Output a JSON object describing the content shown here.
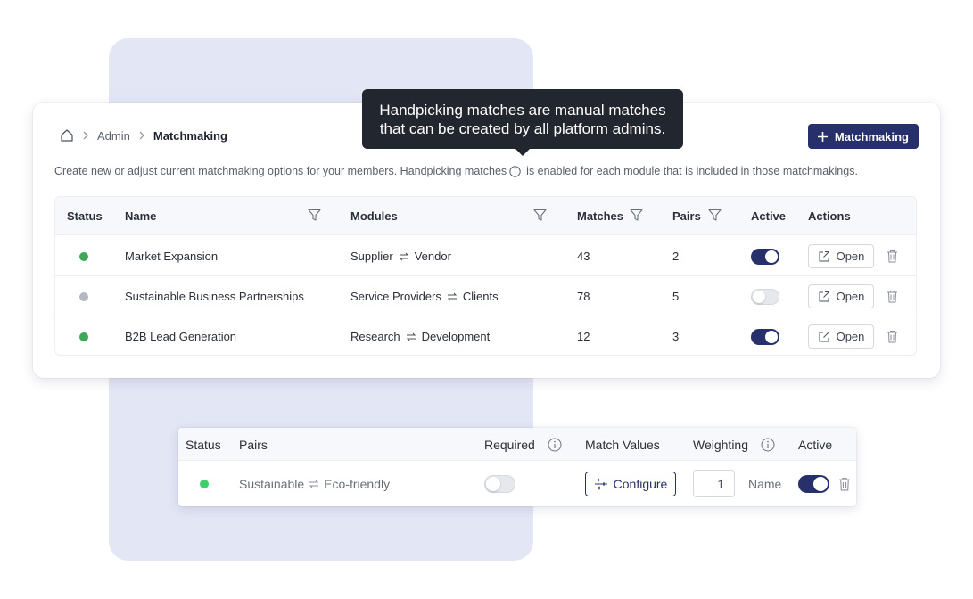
{
  "breadcrumb": {
    "admin": "Admin",
    "current": "Matchmaking"
  },
  "add_button_label": "Matchmaking",
  "description": {
    "before": "Create new or adjust current matchmaking options for your members. Handpicking matches",
    "after": "is enabled for each module that is included in those matchmakings."
  },
  "tooltip": {
    "line1": "Handpicking matches are manual matches",
    "line2": "that can be created by all platform admins."
  },
  "table": {
    "headers": {
      "status": "Status",
      "name": "Name",
      "modules": "Modules",
      "matches": "Matches",
      "pairs": "Pairs",
      "active": "Active",
      "actions": "Actions"
    },
    "open_label": "Open",
    "rows": [
      {
        "status": "active",
        "status_color": "#3ea85a",
        "name": "Market Expansion",
        "module_a": "Supplier",
        "module_b": "Vendor",
        "matches": "43",
        "pairs": "2",
        "active": true
      },
      {
        "status": "inactive",
        "status_color": "#b5b8c2",
        "name": "Sustainable Business Partnerships",
        "module_a": "Service Providers",
        "module_b": "Clients",
        "matches": "78",
        "pairs": "5",
        "active": false
      },
      {
        "status": "active",
        "status_color": "#3ea85a",
        "name": "B2B Lead Generation",
        "module_a": "Research",
        "module_b": "Development",
        "matches": "12",
        "pairs": "3",
        "active": true
      }
    ]
  },
  "pairs_table": {
    "headers": {
      "status": "Status",
      "pairs": "Pairs",
      "required": "Required",
      "match_values": "Match Values",
      "weighting": "Weighting",
      "active": "Active"
    },
    "row": {
      "status_color": "#3fcf6a",
      "pair_a": "Sustainable",
      "pair_b": "Eco-friendly",
      "required": false,
      "configure_label": "Configure",
      "weighting": "1",
      "name_label": "Name",
      "active": true
    }
  },
  "colors": {
    "accent": "#27306b",
    "background_panel": "#e3e6f5",
    "tooltip": "#22262e"
  },
  "icons": [
    "home-icon",
    "chevron-right-icon",
    "plus-icon",
    "info-icon",
    "filter-icon",
    "swap-arrows-icon",
    "external-link-icon",
    "trash-icon",
    "sliders-icon"
  ]
}
